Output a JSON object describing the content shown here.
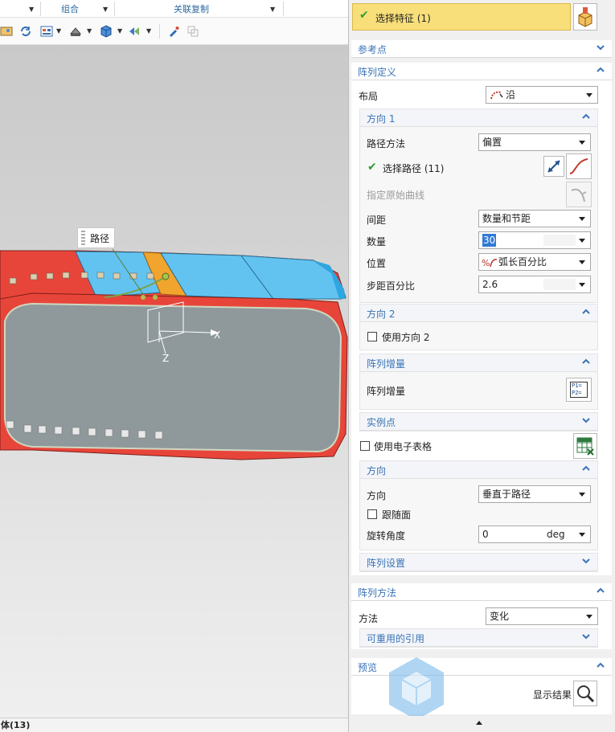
{
  "ribbon": {
    "groups": [
      "组合",
      "关联复制"
    ]
  },
  "status_bar": {
    "text": "体(13)"
  },
  "viewport": {
    "path_tag": "路径",
    "axis_x": "X",
    "axis_z": "Z"
  },
  "dialog": {
    "select_feature": {
      "label": "选择特征 (1)"
    },
    "reference_point": {
      "title": "参考点"
    },
    "array_definition": {
      "title": "阵列定义",
      "layout_label": "布局",
      "layout_value": "沿",
      "direction1": {
        "title": "方向 1",
        "path_method_label": "路径方法",
        "path_method_value": "偏置",
        "select_path_label": "选择路径 (11)",
        "specify_curve_label": "指定原始曲线",
        "spacing_label": "间距",
        "spacing_value": "数量和节距",
        "count_label": "数量",
        "count_value": "30",
        "position_label": "位置",
        "position_value": "弧长百分比",
        "pitch_percent_label": "步距百分比",
        "pitch_percent_value": "2.6"
      },
      "direction2": {
        "title": "方向 2",
        "use_direction2_label": "使用方向 2"
      },
      "increment": {
        "title": "阵列增量",
        "label": "阵列增量",
        "button_text": "P1= P2="
      },
      "instance_points": {
        "title": "实例点"
      },
      "spreadsheet_label": "使用电子表格",
      "orientation": {
        "title": "方向",
        "direction_label": "方向",
        "direction_value": "垂直于路径",
        "follow_face_label": "跟随面",
        "rotation_label": "旋转角度",
        "rotation_value": "0",
        "rotation_unit": "deg"
      },
      "array_settings_title": "阵列设置"
    },
    "array_method": {
      "title": "阵列方法",
      "method_label": "方法",
      "method_value": "变化",
      "reusable_refs_title": "可重用的引用"
    },
    "preview": {
      "title": "预览",
      "show_result_label": "显示结果"
    }
  },
  "colors": {
    "accent": "#3a73b6",
    "select_bar": "#f9df7a",
    "green_check": "#2aa03a"
  }
}
